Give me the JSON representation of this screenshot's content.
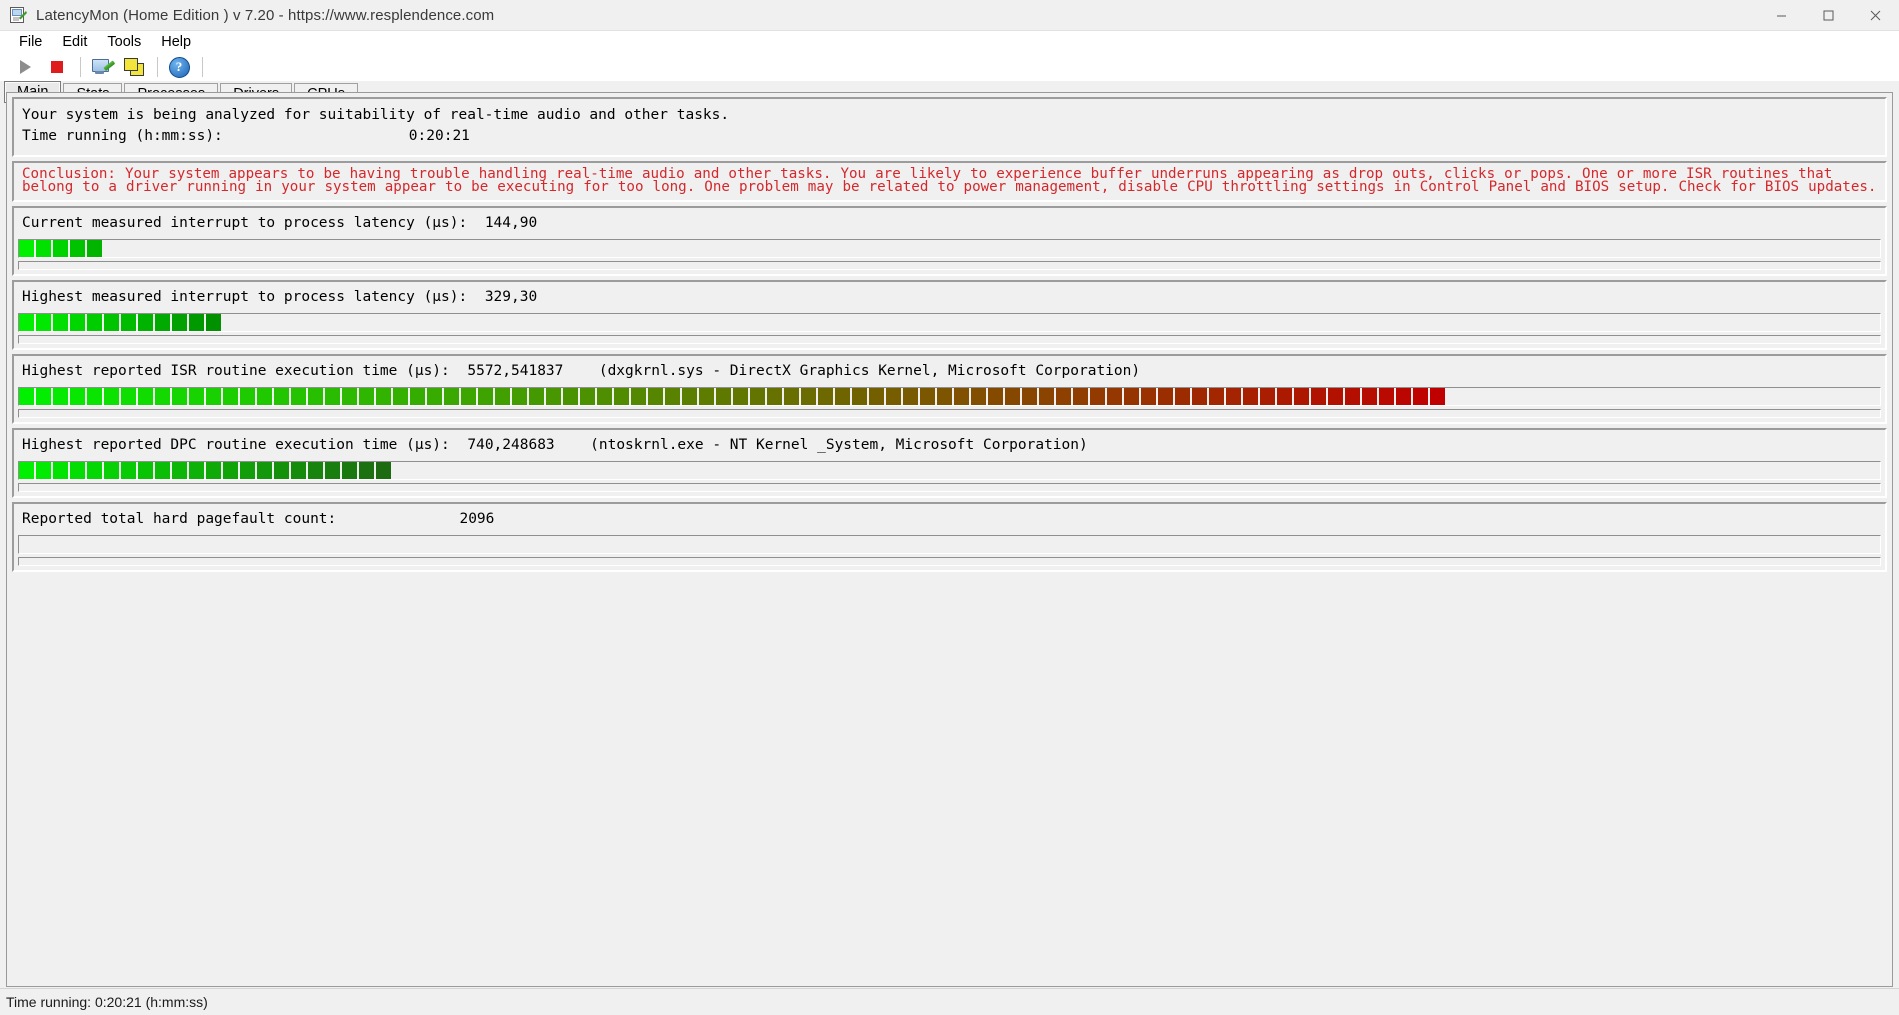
{
  "window": {
    "title": "LatencyMon  (Home Edition )  v 7.20 - https://www.resplendence.com",
    "icon": "latencymon-app-icon",
    "minimize": "—",
    "maximize": "☐",
    "close": "✕"
  },
  "menu": {
    "items": [
      {
        "label": "File"
      },
      {
        "label": "Edit"
      },
      {
        "label": "Tools"
      },
      {
        "label": "Help"
      }
    ]
  },
  "toolbar": {
    "buttons": [
      {
        "name": "start-monitoring-button",
        "icon": "play-icon",
        "label": ""
      },
      {
        "name": "stop-monitoring-button",
        "icon": "stop-icon",
        "label": ""
      },
      {
        "name": "system-info-button",
        "icon": "monitor-pen-icon",
        "label": ""
      },
      {
        "name": "windows-button",
        "icon": "stacked-windows-icon",
        "label": ""
      },
      {
        "name": "help-button",
        "icon": "help-icon",
        "label": "?"
      }
    ]
  },
  "tabs": {
    "items": [
      {
        "label": "Main",
        "active": true
      },
      {
        "label": "Stats",
        "active": false
      },
      {
        "label": "Processes",
        "active": false
      },
      {
        "label": "Drivers",
        "active": false
      },
      {
        "label": "CPUs",
        "active": false
      }
    ]
  },
  "header": {
    "analysis_line": "Your system is being analyzed for suitability of real-time audio and other tasks.",
    "time_label": "Time running (h:mm:ss):",
    "time_value": "0:20:21"
  },
  "conclusion": {
    "text": "Conclusion: Your system appears to be having trouble handling real-time audio and other tasks. You are likely to experience buffer underruns appearing as drop outs, clicks or pops. One or more ISR routines that belong to a driver running in your system appear to be executing for too long. One problem may be related to power management, disable CPU throttling settings in Control Panel and BIOS setup. Check for BIOS updates.",
    "color": "#d4282c"
  },
  "metrics": [
    {
      "name": "current-interrupt-to-process-latency",
      "label": "Current measured interrupt to process latency (µs):",
      "value": "144,90",
      "detail": "",
      "bar_segments": 5,
      "bar_color_start": "#00f000",
      "bar_color_end": "#00b400"
    },
    {
      "name": "highest-interrupt-to-process-latency",
      "label": "Highest measured interrupt to process latency (µs):",
      "value": "329,30",
      "detail": "",
      "bar_segments": 12,
      "bar_color_start": "#00f000",
      "bar_color_end": "#009000"
    },
    {
      "name": "highest-isr-routine-execution-time",
      "label": "Highest reported ISR routine execution time (µs):",
      "value": "5572,541837",
      "detail": "(dxgkrnl.sys - DirectX Graphics Kernel, Microsoft Corporation)",
      "bar_segments": 84,
      "bar_color_start": "#00f000",
      "bar_color_end": "#c00000"
    },
    {
      "name": "highest-dpc-routine-execution-time",
      "label": "Highest reported DPC routine execution time (µs):",
      "value": "740,248683",
      "detail": "(ntoskrnl.exe - NT Kernel _System, Microsoft Corporation)",
      "bar_segments": 22,
      "bar_color_start": "#00f000",
      "bar_color_end": "#1c6b10"
    },
    {
      "name": "reported-total-hard-pagefault-count",
      "label": "Reported total hard pagefault count:",
      "value": "2096",
      "detail": "",
      "bar_segments": 0,
      "bar_color_start": "#00f000",
      "bar_color_end": "#00b400"
    }
  ],
  "statusbar": {
    "text": "Time running: 0:20:21  (h:mm:ss)"
  }
}
